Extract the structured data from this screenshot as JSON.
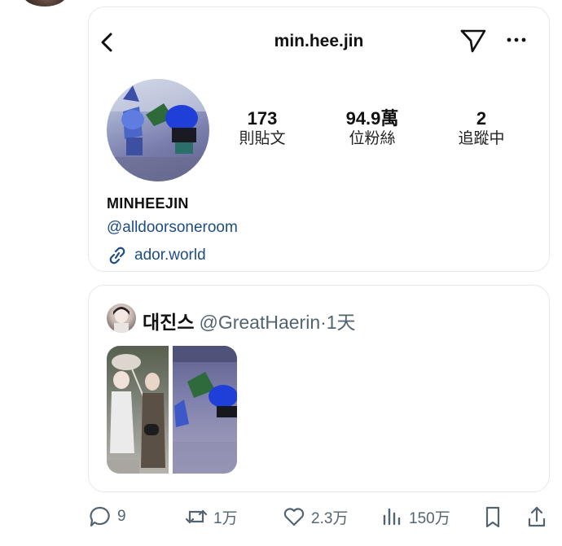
{
  "profile": {
    "handle": "min.hee.jin",
    "display_name": "MINHEEJIN",
    "link_handle": "@alldoorsoneroom",
    "website": "ador.world",
    "stats": [
      {
        "value": "173",
        "label": "則貼文"
      },
      {
        "value": "94.9萬",
        "label": "位粉絲"
      },
      {
        "value": "2",
        "label": "追蹤中"
      }
    ]
  },
  "tweet": {
    "author_name": "대진스",
    "author_handle": "@GreatHaerin",
    "time": "·1天"
  },
  "actions": {
    "replies": "9",
    "retweets": "1万",
    "likes": "2.3万",
    "views": "150万"
  },
  "icons": [
    "back-arrow-icon",
    "send-icon",
    "more-icon",
    "link-icon",
    "reply-icon",
    "retweet-icon",
    "like-icon",
    "views-icon",
    "bookmark-icon",
    "share-icon"
  ],
  "colors": {
    "link": "#1d4d84",
    "muted": "#536471",
    "border": "#e6e8eb"
  }
}
